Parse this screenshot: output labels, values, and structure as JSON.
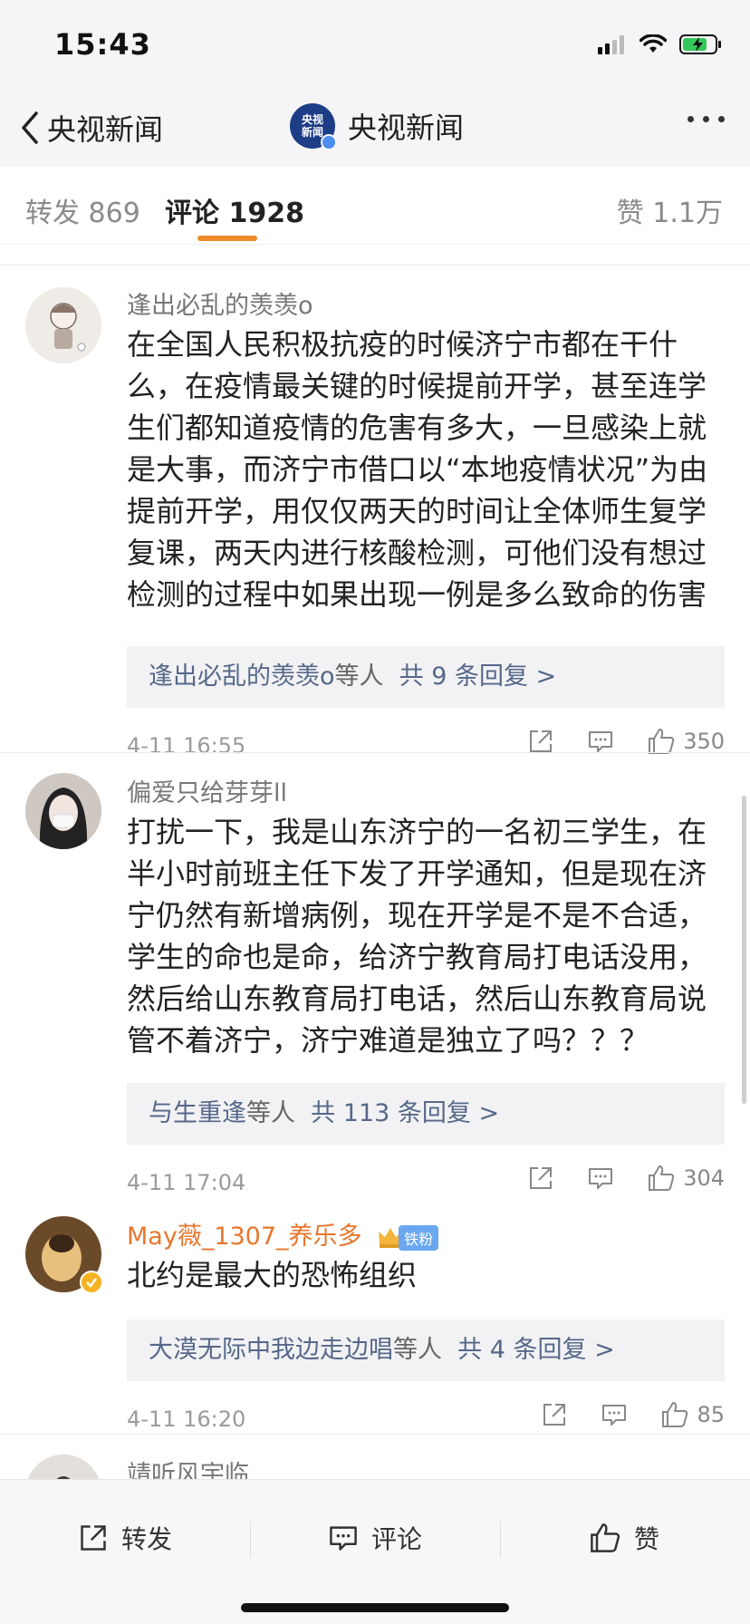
{
  "status_bar": {
    "time": "15:43"
  },
  "nav": {
    "back_label": "央视新闻",
    "title": "央视新闻",
    "logo_text_line1": "央视",
    "logo_text_line2": "新闻"
  },
  "tabs": {
    "repost": "转发 869",
    "comments": "评论 1928",
    "likes": "赞 1.1万"
  },
  "comments": [
    {
      "username": "逢出必乱的羡羡o",
      "text": "在全国人民积极抗疫的时候济宁市都在干什么，在疫情最关键的时候提前开学，甚至连学生们都知道疫情的危害有多大，一旦感染上就是大事，而济宁市借口以“本地疫情状况”为由提前开学，用仅仅两天的时间让全体师生复学复课，两天内进行核酸检测，可他们没有想过检测的过程中如果出现一例是多么致命的伤害",
      "reply_who": "逢出必乱的羡羡o",
      "reply_etc": "等人",
      "reply_count": "共 9 条回复 >",
      "time": "4-11 16:55",
      "likes": "350"
    },
    {
      "username": "偏爱只给芽芽ll",
      "text": "打扰一下，我是山东济宁的一名初三学生，在半小时前班主任下发了开学通知，但是现在济宁仍然有新增病例，现在开学是不是不合适，学生的命也是命，给济宁教育局打电话没用，然后给山东教育局打电话，然后山东教育局说管不着济宁，济宁难道是独立了吗？？？",
      "reply_who": "与生重逢",
      "reply_etc": "等人",
      "reply_count": "共 113 条回复 >",
      "time": "4-11 17:04",
      "likes": "304"
    },
    {
      "username": "May薇_1307_养乐多",
      "badge": "铁粉",
      "text": "北约是最大的恐怖组织",
      "reply_who": "大漠无际中我边走边唱",
      "reply_etc": "等人",
      "reply_count": "共 4 条回复 >",
      "time": "4-11 16:20",
      "likes": "85"
    },
    {
      "username": "靖听风宇临_"
    }
  ],
  "bottom_bar": {
    "repost": "转发",
    "comment": "评论",
    "like": "赞"
  },
  "colors": {
    "accent": "#f08a2a",
    "reply_link": "#56688a",
    "vip_name": "#e8762d"
  }
}
